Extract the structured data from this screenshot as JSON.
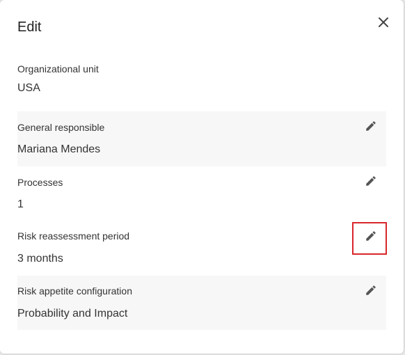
{
  "dialog": {
    "title": "Edit",
    "close_icon": "close-icon"
  },
  "fields": [
    {
      "label": "Organizational unit",
      "value": "USA",
      "editable": false
    },
    {
      "label": "General responsible",
      "value": "Mariana Mendes",
      "editable": true,
      "icon": "pencil-icon"
    },
    {
      "label": "Processes",
      "value": "1",
      "editable": true,
      "icon": "pencil-icon"
    },
    {
      "label": "Risk reassessment period",
      "value": "3 months",
      "editable": true,
      "icon": "pencil-icon",
      "highlighted": true
    },
    {
      "label": "Risk appetite configuration",
      "value": "Probability and Impact",
      "editable": true,
      "icon": "pencil-icon"
    }
  ],
  "colors": {
    "highlight": "#d9262a",
    "row_shade": "#f7f7f7",
    "icon": "#555555"
  }
}
